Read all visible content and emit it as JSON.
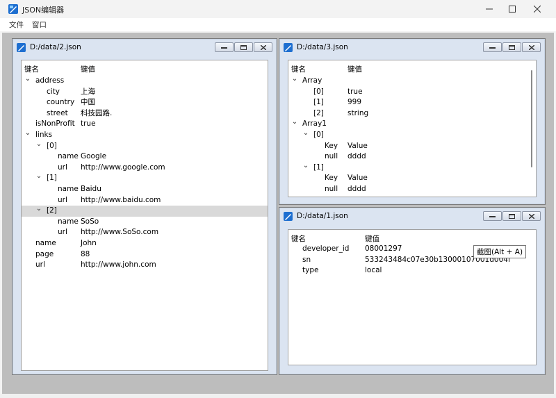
{
  "app": {
    "title": "JSON编辑器"
  },
  "menubar": {
    "items": [
      "文件",
      "窗口"
    ]
  },
  "windows": {
    "w2": {
      "title": "D:/data/2.json",
      "headers": {
        "key": "键名",
        "value": "键值"
      },
      "rows": [
        {
          "depth": 0,
          "arrow": "open",
          "key": "address",
          "value": ""
        },
        {
          "depth": 1,
          "arrow": "none",
          "key": "city",
          "value": "上海"
        },
        {
          "depth": 1,
          "arrow": "none",
          "key": "country",
          "value": "中国"
        },
        {
          "depth": 1,
          "arrow": "none",
          "key": "street",
          "value": "科技园路."
        },
        {
          "depth": 0,
          "arrow": "none",
          "key": "isNonProfit",
          "value": "true"
        },
        {
          "depth": 0,
          "arrow": "open",
          "key": "links",
          "value": ""
        },
        {
          "depth": 1,
          "arrow": "open",
          "key": "[0]",
          "value": ""
        },
        {
          "depth": 2,
          "arrow": "none",
          "key": "name",
          "value": "Google"
        },
        {
          "depth": 2,
          "arrow": "none",
          "key": "url",
          "value": "http://www.google.com"
        },
        {
          "depth": 1,
          "arrow": "open",
          "key": "[1]",
          "value": ""
        },
        {
          "depth": 2,
          "arrow": "none",
          "key": "name",
          "value": "Baidu"
        },
        {
          "depth": 2,
          "arrow": "none",
          "key": "url",
          "value": "http://www.baidu.com"
        },
        {
          "depth": 1,
          "arrow": "open",
          "key": "[2]",
          "value": "",
          "selected": true
        },
        {
          "depth": 2,
          "arrow": "none",
          "key": "name",
          "value": "SoSo"
        },
        {
          "depth": 2,
          "arrow": "none",
          "key": "url",
          "value": "http://www.SoSo.com"
        },
        {
          "depth": 0,
          "arrow": "none",
          "key": "name",
          "value": "John"
        },
        {
          "depth": 0,
          "arrow": "none",
          "key": "page",
          "value": "88"
        },
        {
          "depth": 0,
          "arrow": "none",
          "key": "url",
          "value": "http://www.john.com"
        }
      ]
    },
    "w3": {
      "title": "D:/data/3.json",
      "headers": {
        "key": "键名",
        "value": "键值"
      },
      "rows": [
        {
          "depth": 0,
          "arrow": "open",
          "key": "Array",
          "value": ""
        },
        {
          "depth": 1,
          "arrow": "none",
          "key": "[0]",
          "value": "true"
        },
        {
          "depth": 1,
          "arrow": "none",
          "key": "[1]",
          "value": "999"
        },
        {
          "depth": 1,
          "arrow": "none",
          "key": "[2]",
          "value": "string"
        },
        {
          "depth": 0,
          "arrow": "open",
          "key": "Array1",
          "value": ""
        },
        {
          "depth": 1,
          "arrow": "open",
          "key": "[0]",
          "value": ""
        },
        {
          "depth": 2,
          "arrow": "none",
          "key": "Key",
          "value": "Value"
        },
        {
          "depth": 2,
          "arrow": "none",
          "key": "null",
          "value": "dddd"
        },
        {
          "depth": 1,
          "arrow": "open",
          "key": "[1]",
          "value": ""
        },
        {
          "depth": 2,
          "arrow": "none",
          "key": "Key",
          "value": "Value"
        },
        {
          "depth": 2,
          "arrow": "none",
          "key": "null",
          "value": "dddd"
        }
      ]
    },
    "w1": {
      "title": "D:/data/1.json",
      "headers": {
        "key": "键名",
        "value": "键值"
      },
      "rows": [
        {
          "depth": 1,
          "arrow": "none",
          "key": "developer_id",
          "value": "08001297"
        },
        {
          "depth": 1,
          "arrow": "none",
          "key": "sn",
          "value": "533243484c07e30b13000107001d004f"
        },
        {
          "depth": 1,
          "arrow": "none",
          "key": "type",
          "value": "local"
        }
      ]
    }
  },
  "tooltip": {
    "text": "截图(Alt + A)"
  }
}
